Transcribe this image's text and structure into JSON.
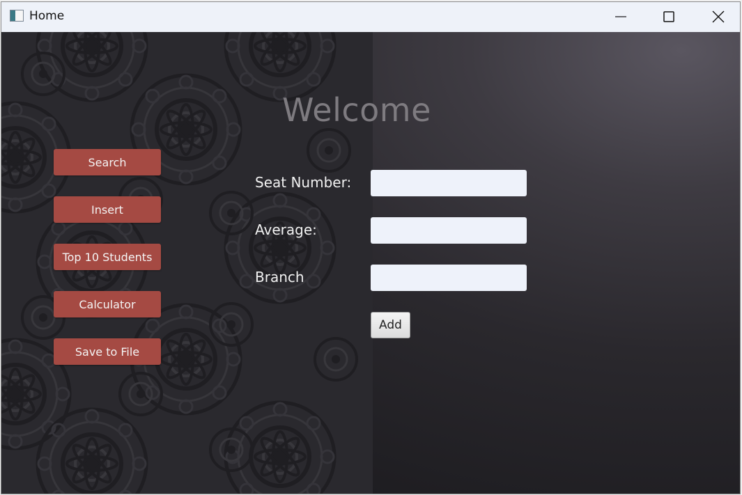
{
  "window": {
    "title": "Home",
    "icon": "app-window-icon",
    "controls": [
      "minimize-icon",
      "maximize-icon",
      "close-icon"
    ]
  },
  "sidebar": {
    "items": [
      {
        "label": "Search"
      },
      {
        "label": "Insert"
      },
      {
        "label": "Top 10 Students"
      },
      {
        "label": "Calculator"
      },
      {
        "label": "Save to File"
      }
    ]
  },
  "main": {
    "heading": "Welcome",
    "form": {
      "seat_number": {
        "label": "Seat Number:",
        "value": ""
      },
      "average": {
        "label": "Average:",
        "value": ""
      },
      "branch": {
        "label": "Branch",
        "value": ""
      },
      "submit_label": "Add"
    }
  },
  "colors": {
    "button_accent": "#a54a43",
    "input_background": "#eef2fa",
    "heading_color": "#7e7b80"
  }
}
